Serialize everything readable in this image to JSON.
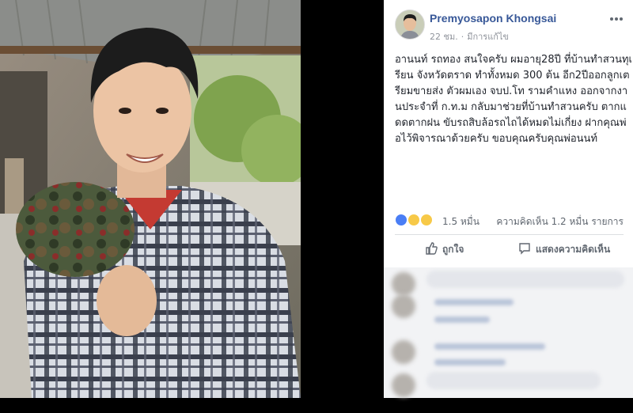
{
  "post": {
    "author": "Premyosapon Khongsai",
    "time": "22 ชม.",
    "edited": "มีการแก้ไข",
    "body": "อานนท์ รถทอง สนใจครับ ผมอายุ28ปี ที่บ้านทำสวนทุเรียน จังหวัดตราด ทำทั้งหมด 300 ต้น อีก2ปีออกลูกเตรียมขายส่ง ตัวผมเอง จบป.โท รามคำแหง ออกจากงานประจำที่ ก.ท.ม กลับมาช่วยที่บ้านทำสวนครับ ตากแดดตากฝน ขับรถสิบล้อรถไถได้หมดไม่เกี่ยง ฝากคุณพ่อไว้พิจารณาด้วยครับ ขอบคุณครับคุณพ่อนนท์",
    "reactions_count": "1.5 หมื่น",
    "comments_count": "ความคิดเห็น 1.2 หมื่น รายการ",
    "like_label": "ถูกใจ",
    "comment_label": "แสดงความคิดเห็น"
  },
  "colors": {
    "link": "#385898",
    "like": "#4a7ef5",
    "emoji": "#f7c948"
  },
  "icons": {
    "more": "more-dots-icon",
    "like": "thumbs-up-icon",
    "comment": "comment-bubble-icon"
  }
}
